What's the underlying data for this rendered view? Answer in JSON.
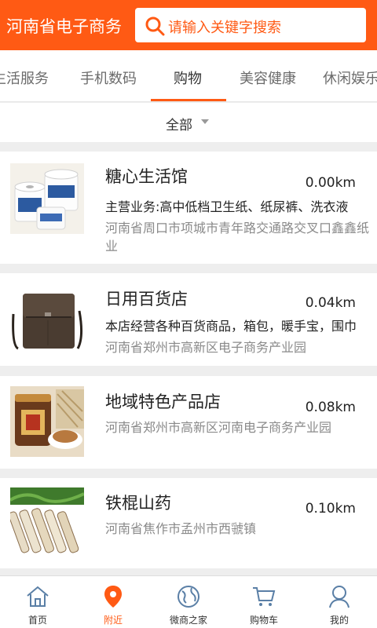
{
  "header": {
    "title": "河南省电子商务",
    "search_placeholder": "请输入关键字搜索",
    "brand_color": "#ff5a14"
  },
  "tabs": [
    {
      "label": "生活服务"
    },
    {
      "label": "手机数码"
    },
    {
      "label": "购物",
      "active": true
    },
    {
      "label": "美容健康"
    },
    {
      "label": "休闲娱乐"
    }
  ],
  "filter": {
    "label": "全部"
  },
  "shops": [
    {
      "name": "糖心生活馆",
      "distance": "0.00km",
      "business": "主营业务:高中低档卫生纸、纸尿裤、洗衣液",
      "address": "河南省周口市项城市青年路交通路交叉口鑫鑫纸业",
      "thumb_icon": "toilet-paper-photo"
    },
    {
      "name": "日用百货店",
      "distance": "0.04km",
      "business": "本店经营各种百货商品，箱包，暖手宝，围巾",
      "address": "河南省郑州市高新区电子商务产业园",
      "thumb_icon": "leather-bag-photo"
    },
    {
      "name": "地域特色产品店",
      "distance": "0.08km",
      "business": "",
      "address": "河南省郑州市高新区河南电子商务产业园",
      "thumb_icon": "specialty-jar-photo"
    },
    {
      "name": "铁棍山药",
      "distance": "0.10km",
      "business": "",
      "address": "河南省焦作市孟州市西虢镇",
      "thumb_icon": "yam-photo"
    }
  ],
  "bottom_nav": [
    {
      "label": "首页",
      "icon": "home-icon"
    },
    {
      "label": "附近",
      "icon": "location-pin-icon",
      "active": true
    },
    {
      "label": "微商之家",
      "icon": "globe-icon"
    },
    {
      "label": "购物车",
      "icon": "cart-icon"
    },
    {
      "label": "我的",
      "icon": "user-icon"
    }
  ]
}
